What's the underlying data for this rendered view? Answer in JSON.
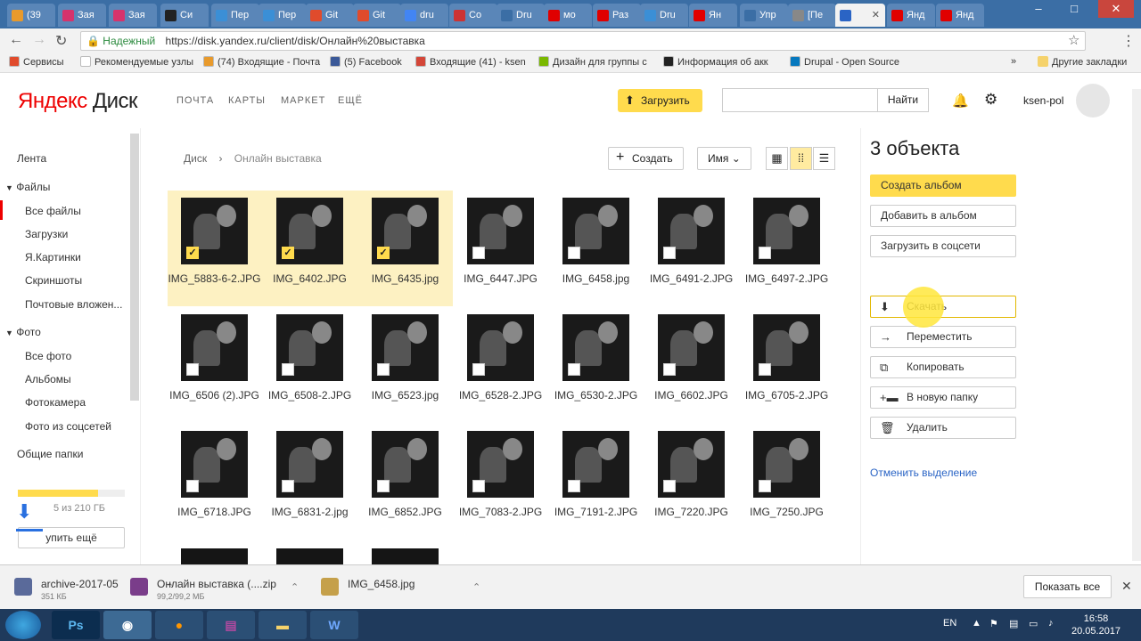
{
  "browser": {
    "tabs": [
      {
        "label": "(39",
        "color": "#e89a2c"
      },
      {
        "label": "Зая",
        "color": "#d6336c"
      },
      {
        "label": "Зая",
        "color": "#d6336c"
      },
      {
        "label": "Си",
        "color": "#222222"
      },
      {
        "label": "Пер",
        "color": "#3b8fd6"
      },
      {
        "label": "Пер",
        "color": "#3b8fd6"
      },
      {
        "label": "Git",
        "color": "#e04b2c"
      },
      {
        "label": "Git",
        "color": "#e04b2c"
      },
      {
        "label": "dru",
        "color": "#4285f4"
      },
      {
        "label": "Co",
        "color": "#cc3333"
      },
      {
        "label": "Dru",
        "color": "#3b6ea5"
      },
      {
        "label": "мо",
        "color": "#e00000"
      },
      {
        "label": "Раз",
        "color": "#e00000"
      },
      {
        "label": "Dru",
        "color": "#3b8fd6"
      },
      {
        "label": "Ян",
        "color": "#e00000"
      },
      {
        "label": "Упр",
        "color": "#3b6ea5"
      },
      {
        "label": "[Пе",
        "color": "#888888"
      },
      {
        "label": "",
        "color": "#2a64c5",
        "active": true
      },
      {
        "label": "Янд",
        "color": "#e00000"
      },
      {
        "label": "Янд",
        "color": "#e00000"
      }
    ],
    "url_secure_label": "Надежный",
    "url": "https://disk.yandex.ru/client/disk/Онлайн%20выставка",
    "bookmarks": [
      {
        "label": "Сервисы",
        "color": "#e04b2c"
      },
      {
        "label": "Рекомендуемые узлы",
        "color": "#ffffff"
      },
      {
        "label": "(74) Входящие - Почта",
        "color": "#e89a2c"
      },
      {
        "label": "(5) Facebook",
        "color": "#3b5998"
      },
      {
        "label": "Входящие (41) - ksen",
        "color": "#d44638"
      },
      {
        "label": "Дизайн для группы с",
        "color": "#7ab800"
      },
      {
        "label": "Информация об акк",
        "color": "#222222"
      },
      {
        "label": "Drupal - Open Source",
        "color": "#0678be"
      }
    ],
    "other_bookmarks": "Другие закладки"
  },
  "header": {
    "logo_ya": "Яндекс",
    "logo_disk": "Диск",
    "nav": [
      "ПОЧТА",
      "КАРТЫ",
      "МАРКЕТ",
      "ЕЩЁ"
    ],
    "upload_label": "Загрузить",
    "search_placeholder": "",
    "search_button": "Найти",
    "username": "ksen-pol"
  },
  "sidebar": {
    "items": [
      {
        "label": "Лента"
      },
      {
        "label": "Файлы"
      },
      {
        "label": "Все файлы"
      },
      {
        "label": "Загрузки"
      },
      {
        "label": "Я.Картинки"
      },
      {
        "label": "Скриншоты"
      },
      {
        "label": "Почтовые вложен..."
      },
      {
        "label": "Фото"
      },
      {
        "label": "Все фото"
      },
      {
        "label": "Альбомы"
      },
      {
        "label": "Фотокамера"
      },
      {
        "label": "Фото из соцсетей"
      },
      {
        "label": "Общие папки"
      }
    ],
    "quota_text": "5 из 210 ГБ",
    "buy_label": "упить ещё"
  },
  "toolbar": {
    "breadcrumb_root": "Диск",
    "breadcrumb_current": "Онлайн выставка",
    "create_label": "Создать",
    "sort_label": "Имя"
  },
  "files": [
    {
      "name": "IMG_5883-6-2.JPG",
      "selected": true
    },
    {
      "name": "IMG_6402.JPG",
      "selected": true
    },
    {
      "name": "IMG_6435.jpg",
      "selected": true
    },
    {
      "name": "IMG_6447.JPG",
      "selected": false
    },
    {
      "name": "IMG_6458.jpg",
      "selected": false
    },
    {
      "name": "IMG_6491-2.JPG",
      "selected": false
    },
    {
      "name": "IMG_6497-2.JPG",
      "selected": false
    },
    {
      "name": "IMG_6506 (2).JPG",
      "selected": false
    },
    {
      "name": "IMG_6508-2.JPG",
      "selected": false
    },
    {
      "name": "IMG_6523.jpg",
      "selected": false
    },
    {
      "name": "IMG_6528-2.JPG",
      "selected": false
    },
    {
      "name": "IMG_6530-2.JPG",
      "selected": false
    },
    {
      "name": "IMG_6602.JPG",
      "selected": false
    },
    {
      "name": "IMG_6705-2.JPG",
      "selected": false
    },
    {
      "name": "IMG_6718.JPG",
      "selected": false
    },
    {
      "name": "IMG_6831-2.jpg",
      "selected": false
    },
    {
      "name": "IMG_6852.JPG",
      "selected": false
    },
    {
      "name": "IMG_7083-2.JPG",
      "selected": false
    },
    {
      "name": "IMG_7191-2.JPG",
      "selected": false
    },
    {
      "name": "IMG_7220.JPG",
      "selected": false
    },
    {
      "name": "IMG_7250.JPG",
      "selected": false
    }
  ],
  "panel": {
    "count": "3 объекта",
    "create_album": "Создать альбом",
    "add_to_album": "Добавить в альбом",
    "upload_social": "Загрузить в соцсети",
    "actions": [
      {
        "label": "Скачать",
        "icon": "download-icon"
      },
      {
        "label": "Переместить",
        "icon": "move-arrow-icon"
      },
      {
        "label": "Копировать",
        "icon": "copy-icon"
      },
      {
        "label": "В новую папку",
        "icon": "new-folder-icon"
      },
      {
        "label": "Удалить",
        "icon": "trash-icon"
      }
    ],
    "cancel_selection": "Отменить выделение"
  },
  "downloads": [
    {
      "name": "archive-2017-05",
      "size": "351 КБ"
    },
    {
      "name": "Онлайн выставка (....zip",
      "size": "99,2/99,2 МБ"
    },
    {
      "name": "IMG_6458.jpg",
      "size": ""
    }
  ],
  "downloads_show_all": "Показать все",
  "taskbar": {
    "lang": "EN",
    "time": "16:58",
    "date": "20.05.2017"
  }
}
